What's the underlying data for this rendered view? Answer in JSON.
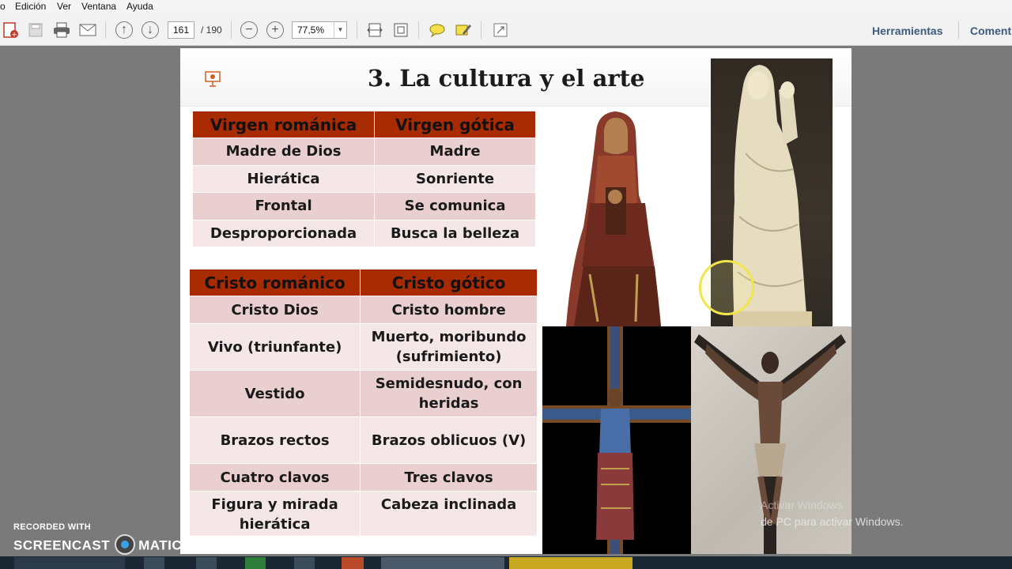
{
  "menu": [
    "Edición",
    "Ver",
    "Ventana",
    "Ayuda"
  ],
  "toolbar": {
    "page_current": "161",
    "page_total": "/ 190",
    "zoom": "77,5%",
    "tools_label": "Herramientas",
    "comment_label": "Coment"
  },
  "slide": {
    "title": "3. La cultura y el arte",
    "virgen_table": {
      "headers": [
        "Virgen románica",
        "Virgen gótica"
      ],
      "rows": [
        [
          "Madre de Dios",
          "Madre"
        ],
        [
          "Hierática",
          "Sonriente"
        ],
        [
          "Frontal",
          "Se comunica"
        ],
        [
          "Desproporcionada",
          "Busca la belleza"
        ]
      ]
    },
    "cristo_table": {
      "headers": [
        "Cristo románico",
        "Cristo gótico"
      ],
      "rows": [
        [
          "Cristo Dios",
          "Cristo hombre"
        ],
        [
          "Vivo (triunfante)",
          "Muerto, moribundo (sufrimiento)"
        ],
        [
          "Vestido",
          "Semidesnudo, con heridas"
        ],
        [
          "Brazos rectos",
          "Brazos oblicuos (V)"
        ],
        [
          "Cuatro clavos",
          "Tres clavos"
        ],
        [
          "Figura y mirada hierática",
          "Cabeza inclinada"
        ]
      ]
    }
  },
  "overlay": {
    "recorded_with": "RECORDED WITH",
    "brand_left": "SCREENCAST",
    "brand_right": "MATIC",
    "activation_line1": "Activar Windows",
    "activation_line2": "de PC para activar Windows."
  },
  "colors": {
    "header_bg": "#a82a00",
    "row_odd": "#e9cfcf",
    "row_even": "#f5e7e7",
    "link": "#3d5a80"
  }
}
